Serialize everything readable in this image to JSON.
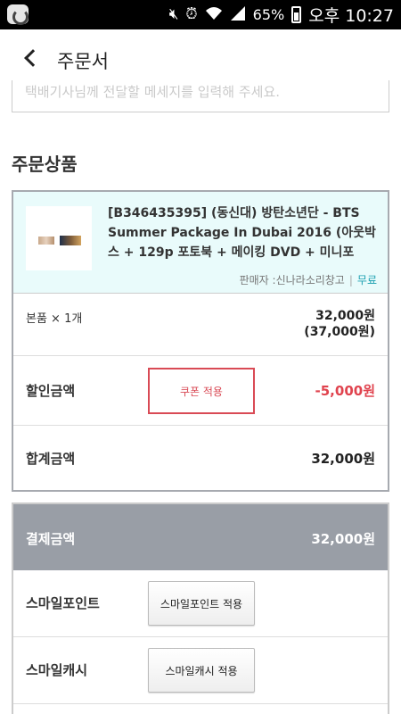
{
  "status_bar": {
    "battery": "65%",
    "time": "오후 10:27",
    "icons": [
      "app-icon",
      "mute-icon",
      "alarm-icon",
      "wifi-icon",
      "signal-icon",
      "battery-icon"
    ]
  },
  "header": {
    "title": "주문서",
    "back_icon": "chevron-left-icon"
  },
  "message_box": {
    "placeholder": "택배기사님께 전달할 메세지를 입력해 주세요."
  },
  "order": {
    "section_title": "주문상품",
    "product": {
      "name": "[B346435395] (동신대) 방탄소년단 - BTS Summer Package In Dubai 2016 (아웃박스 + 129p 포토북 + 메이킹 DVD + 미니포",
      "seller": "판매자 :신나라소리창고",
      "shipping": "무료"
    },
    "quantity_label": "본품 × 1개",
    "price": "32,000원",
    "original_price": "(37,000원)",
    "discount_label": "할인금액",
    "coupon_button": "쿠폰 적용",
    "discount_amount": "-5,000원",
    "total_label": "합계금액",
    "total_amount": "32,000원"
  },
  "payment": {
    "label": "결제금액",
    "amount": "32,000원",
    "smile_point_label": "스마일포인트",
    "smile_point_button": "스마일포인트 적용",
    "smile_cash_label": "스마일캐시",
    "smile_cash_button": "스마일캐시 적용"
  },
  "colors": {
    "accent_red": "#e0434e",
    "teal": "#1a9fb0",
    "product_bg": "#e9fbfb",
    "payment_header": "#999ea6"
  }
}
